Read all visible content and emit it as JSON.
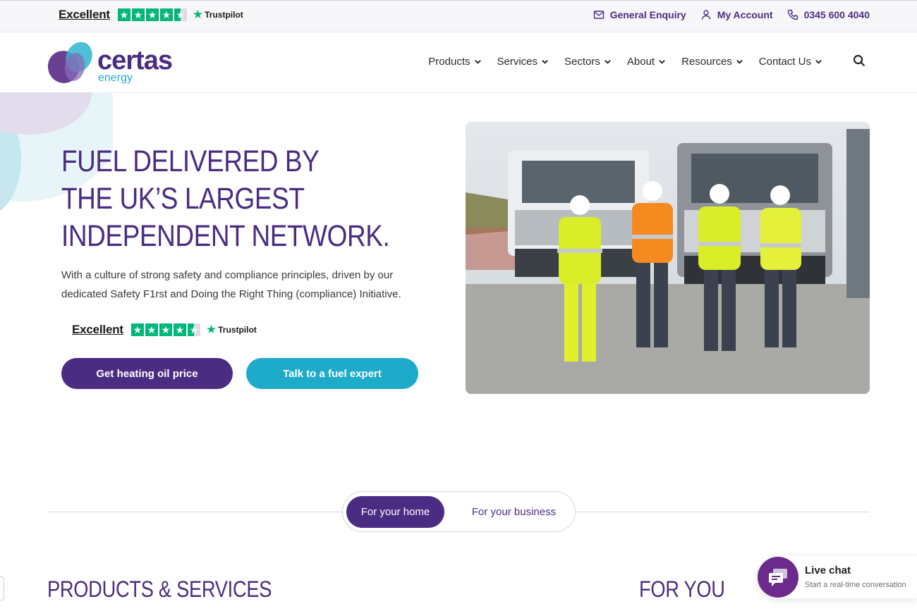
{
  "topbar": {
    "trustpilot": {
      "rating_word": "Excellent",
      "brand": "Trustpilot",
      "stars": 4.5
    },
    "links": [
      {
        "label": "General Enquiry",
        "icon": "mail-icon"
      },
      {
        "label": "My Account",
        "icon": "user-icon"
      },
      {
        "label": "0345 600 4040",
        "icon": "phone-icon"
      }
    ]
  },
  "header": {
    "logo": {
      "name": "certas",
      "sub": "energy"
    },
    "nav": [
      {
        "label": "Products"
      },
      {
        "label": "Services"
      },
      {
        "label": "Sectors"
      },
      {
        "label": "About"
      },
      {
        "label": "Resources"
      },
      {
        "label": "Contact Us"
      }
    ]
  },
  "hero": {
    "title_lines": [
      "FUEL DELIVERED BY",
      "THE UK’S LARGEST",
      "INDEPENDENT NETWORK."
    ],
    "description": "With a culture of strong safety and compliance principles, driven by our dedicated Safety F1rst and Doing the Right Thing (compliance) Initiative.",
    "trustpilot": {
      "rating_word": "Excellent",
      "brand": "Trustpilot",
      "stars": 4.5
    },
    "primary_button": "Get heating oil price",
    "secondary_button": "Talk to a fuel expert"
  },
  "audience_toggle": {
    "active": "For your home",
    "inactive": "For your business"
  },
  "sections": {
    "products_heading": "PRODUCTS & SERVICES",
    "for_you_heading": "FOR YOU"
  },
  "live_chat": {
    "title": "Live chat",
    "subtitle": "Start a real-time conversation"
  },
  "colors": {
    "brand_purple": "#4b2c83",
    "brand_teal": "#1eaac9",
    "trustpilot_green": "#00b67a"
  }
}
